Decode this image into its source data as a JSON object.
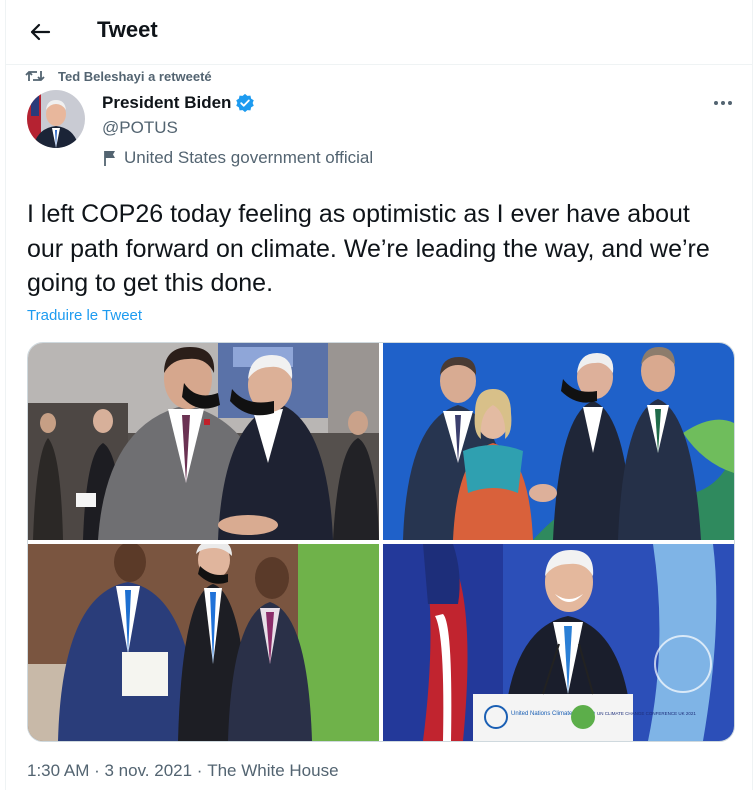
{
  "header": {
    "title": "Tweet"
  },
  "retweet": {
    "text": "Ted Beleshayi a retweeté"
  },
  "author": {
    "name": "President Biden",
    "handle": "@POTUS",
    "label": "United States government official"
  },
  "tweet": {
    "text": "I left COP26 today feeling as optimistic as I ever have about our path forward on climate. We’re leading the way, and we’re going to get this done.",
    "translate": "Traduire le Tweet"
  },
  "photos": {
    "p4_podium_text": "United Nations Climate Change",
    "p4_logo_text": "UN CLIMATE CHANGE CONFERENCE UK 2021"
  },
  "meta": {
    "time": "1:30 AM",
    "separator": " · ",
    "date": "3 nov. 2021",
    "source": "The White House"
  },
  "colors": {
    "accent": "#1d9bf0",
    "secondary_text": "#536471",
    "border": "#eff3f4"
  },
  "icons": [
    "back-arrow-icon",
    "retweet-icon",
    "verified-badge-icon",
    "more-icon",
    "flag-icon"
  ]
}
